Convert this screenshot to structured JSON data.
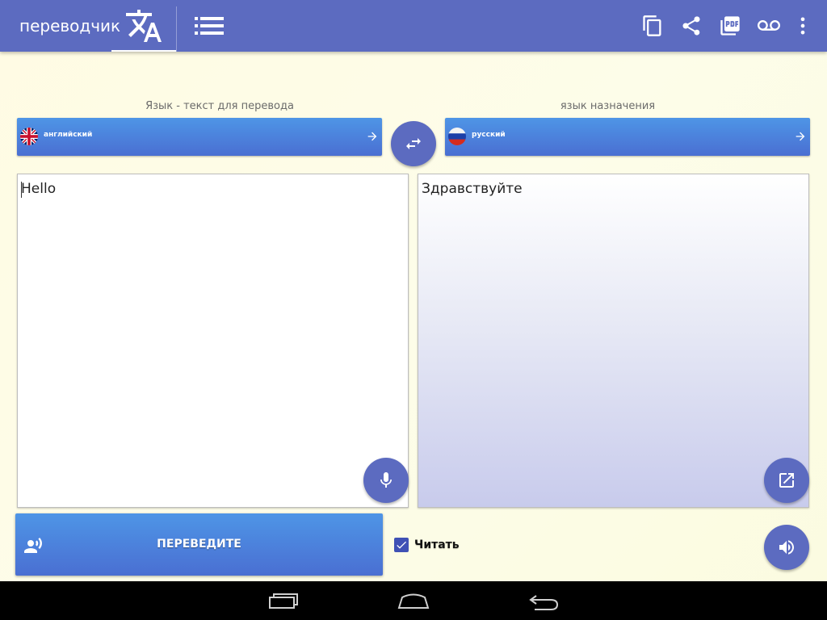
{
  "app": {
    "title": "переводчик"
  },
  "toolbar": {
    "icons": [
      "translate-icon",
      "list-icon",
      "copy-icon",
      "share-icon",
      "pdf-icon",
      "voicemail-icon",
      "more-vert-icon"
    ]
  },
  "source": {
    "caption": "Язык - текст для перевода",
    "language": "английский",
    "text": "Hello"
  },
  "target": {
    "caption": "язык назначения",
    "language": "русский",
    "text": "Здравствуйте"
  },
  "actions": {
    "translate_label": "ПЕРЕВЕДИТЕ",
    "read_label": "Читать",
    "read_checked": true
  },
  "colors": {
    "primary": "#5c6bc0",
    "button_gradient_top": "#4e95e6",
    "button_gradient_bottom": "#4a6fd2",
    "background": "#fdfde9"
  }
}
